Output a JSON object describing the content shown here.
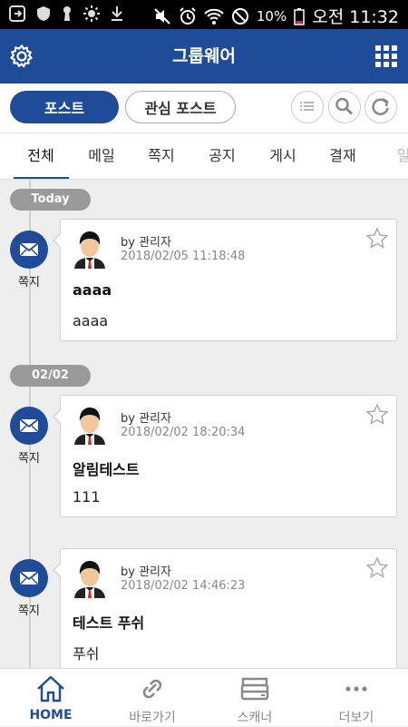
{
  "status_bar": {
    "battery": "10%",
    "time": "오전 11:32"
  },
  "header": {
    "title": "그룹웨어"
  },
  "filter": {
    "post_label": "포스트",
    "favorite_label": "관심 포스트"
  },
  "tabs": [
    {
      "label": "전체",
      "active": true
    },
    {
      "label": "메일"
    },
    {
      "label": "쪽지"
    },
    {
      "label": "공지"
    },
    {
      "label": "게시"
    },
    {
      "label": "결재"
    },
    {
      "label": "일"
    }
  ],
  "groups": [
    {
      "date": "Today",
      "posts": [
        {
          "type_label": "쪽지",
          "author": "by 관리자",
          "timestamp": "2018/02/05 11:18:48",
          "title": "aaaa",
          "body": "aaaa"
        }
      ]
    },
    {
      "date": "02/02",
      "posts": [
        {
          "type_label": "쪽지",
          "author": "by 관리자",
          "timestamp": "2018/02/02 18:20:34",
          "title": "알림테스트",
          "body": "111"
        },
        {
          "type_label": "쪽지",
          "author": "by 관리자",
          "timestamp": "2018/02/02 14:46:23",
          "title": "테스트 푸쉬",
          "body": "푸쉬"
        }
      ]
    }
  ],
  "bottom_nav": [
    {
      "label": "HOME",
      "icon": "home-icon",
      "active": true
    },
    {
      "label": "바로가기",
      "icon": "link-icon"
    },
    {
      "label": "스캐너",
      "icon": "scanner-icon"
    },
    {
      "label": "더보기",
      "icon": "more-icon"
    }
  ],
  "colors": {
    "primary": "#1f4c99",
    "chip": "#9a9a9a",
    "background": "#eeeeee"
  }
}
